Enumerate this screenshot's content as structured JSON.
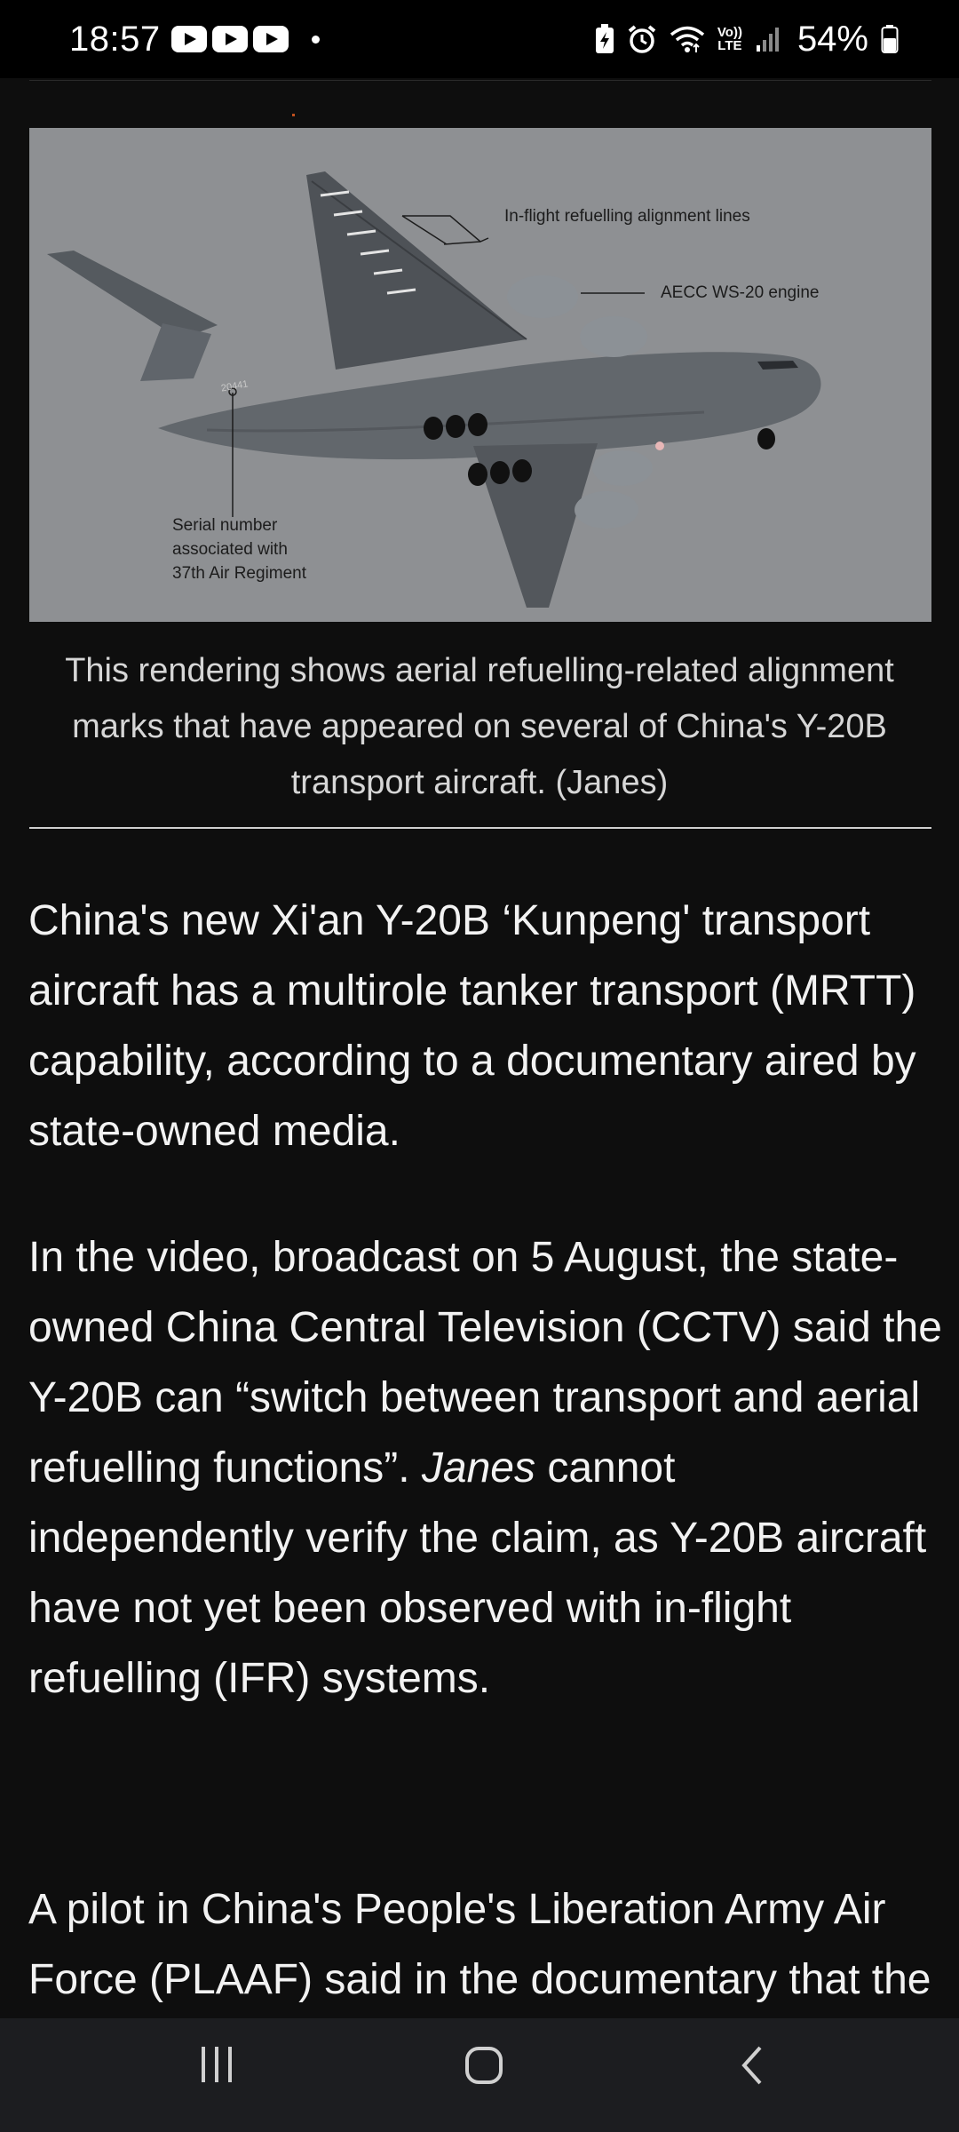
{
  "status_bar": {
    "time": "18:57",
    "notification_icons": [
      "youtube-icon",
      "youtube-icon",
      "youtube-icon"
    ],
    "right_icons": [
      "battery-saver-icon",
      "alarm-icon",
      "wifi-icon",
      "volte-icon",
      "signal-icon"
    ],
    "volte_label_top": "Vo))",
    "volte_label_bottom": "LTE",
    "battery_percent": "54%"
  },
  "figure": {
    "annotations": {
      "refuelling_lines": "In-flight refuelling alignment lines",
      "engine": "AECC WS-20 engine",
      "serial_line1": "Serial number",
      "serial_line2": "associated with",
      "serial_line3": "37th Air Regiment",
      "tail_number": "20441"
    },
    "caption": "This rendering shows aerial refuelling-related alignment marks that have appeared on several of China's Y-20B transport aircraft. (Janes)"
  },
  "article": {
    "paragraph1": "China's new Xi'an Y-20B ‘Kunpeng' transport aircraft has a multirole tanker transport (MRTT) capability, according to a documentary aired by state-owned media.",
    "paragraph2_a": "In the video, broadcast on 5 August, the state-owned China Central Television (CCTV) said the Y-20B can “switch between transport and aerial refuelling functions”.",
    "paragraph2_italic": "Janes",
    "paragraph2_b": "cannot independently verify the claim, as Y-20B aircraft have not yet been observed with in-flight refuelling (IFR) systems.",
    "paragraph3": "A pilot in China's People's Liberation Army Air Force (PLAAF) said in the documentary that the ‘B' variant, which is powered by"
  },
  "nav_bar": {
    "buttons": [
      "recent-apps-icon",
      "home-icon",
      "back-icon"
    ]
  },
  "colors": {
    "background": "#0e0e0e",
    "status_bar": "#000000",
    "nav_bar": "#1c1d20",
    "figure_background": "#8e9093",
    "aircraft_body": "#5d6166",
    "text": "#f2f2f2",
    "caption_text": "#d6d6d6"
  }
}
